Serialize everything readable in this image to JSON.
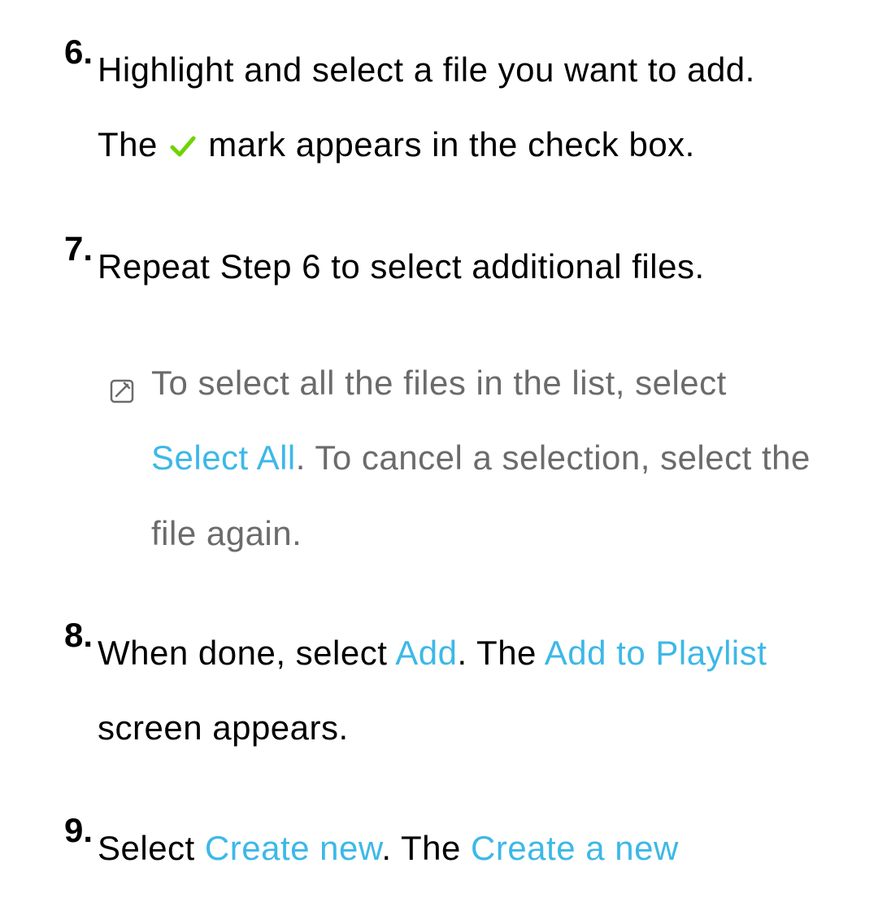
{
  "steps": {
    "s6": {
      "num": "6.",
      "t1": "Highlight and select a file you want to add. The ",
      "t2": " mark appears in the check box."
    },
    "s7": {
      "num": "7.",
      "t1": "Repeat Step 6 to select additional files.",
      "note": {
        "t1": "To select all the files in the list, select ",
        "hl1": "Select All",
        "t2": ". To cancel a selection, select the file again."
      }
    },
    "s8": {
      "num": "8.",
      "t1": "When done, select ",
      "hl1": "Add",
      "t2": ". The ",
      "hl2": "Add to Playlist",
      "t3": " screen appears."
    },
    "s9": {
      "num": "9.",
      "t1": "Select ",
      "hl1": "Create new",
      "t2": ". The ",
      "hl2": "Create a new"
    }
  }
}
